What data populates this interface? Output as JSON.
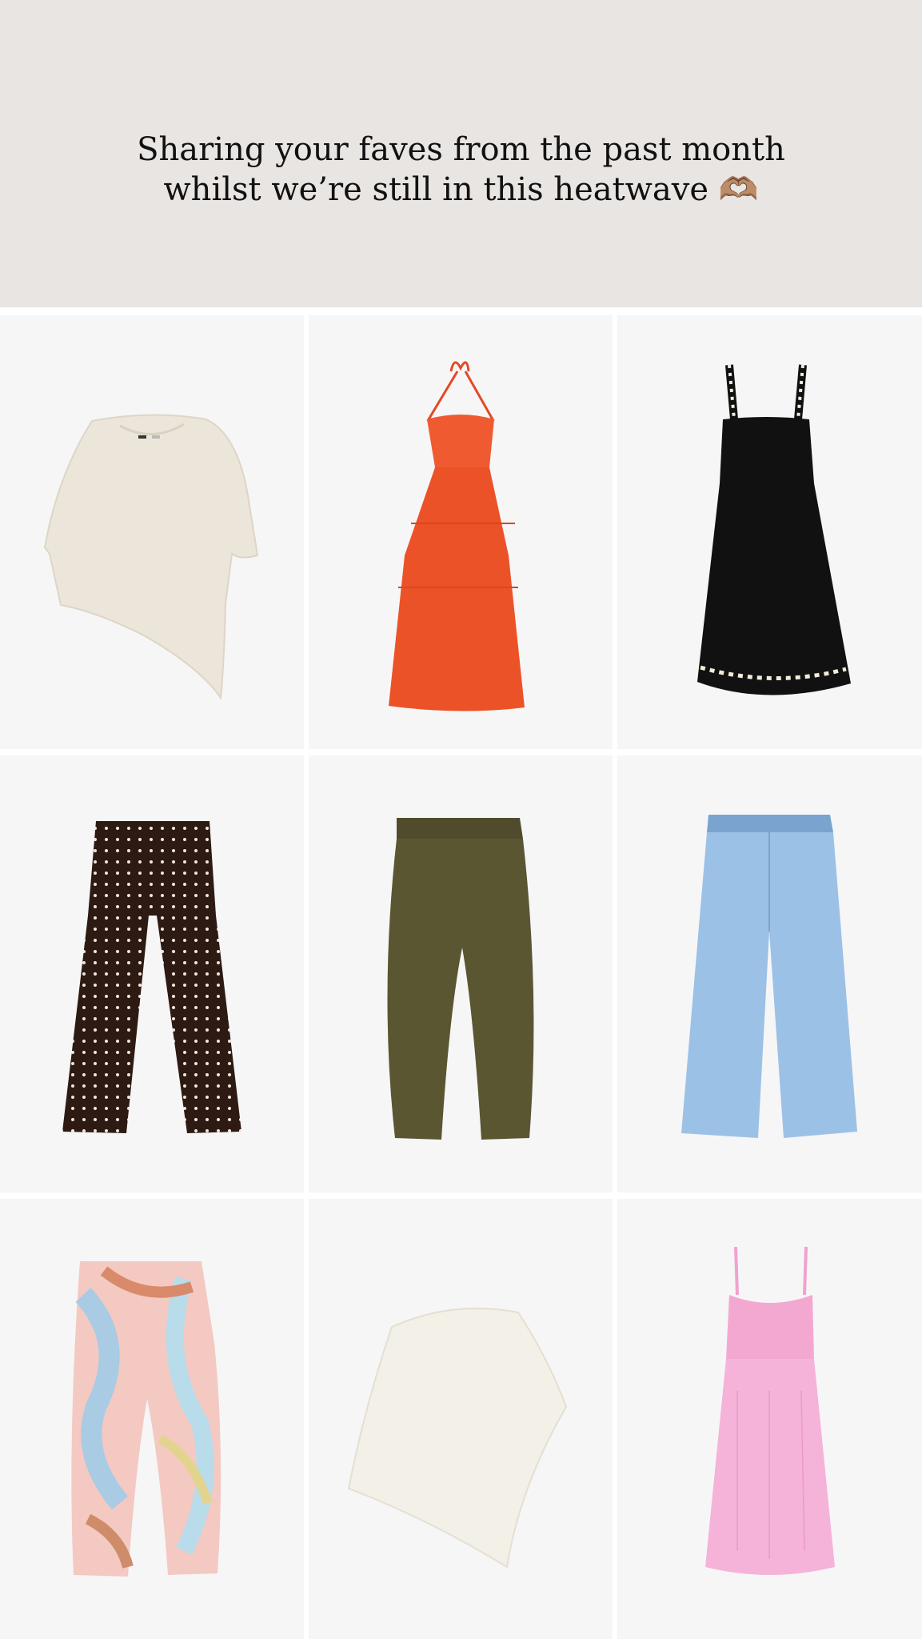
{
  "header": {
    "title": "Sharing your faves from the past month whilst we’re still in this heatwave 🫶🏽"
  },
  "products": [
    {
      "name": "cream asymmetric knit top"
    },
    {
      "name": "red halter tiered maxi dress"
    },
    {
      "name": "black ric-rac trim midi dress"
    },
    {
      "name": "brown polka dot wide trousers"
    },
    {
      "name": "khaki barrel trousers"
    },
    {
      "name": "light wash wide leg jeans"
    },
    {
      "name": "pastel swirl print trousers"
    },
    {
      "name": "white asymmetric knit poncho"
    },
    {
      "name": "pink tiered maxi sundress"
    }
  ],
  "colors": {
    "header_bg": "#e8e5e2",
    "tile_bg": "#f6f6f7"
  }
}
